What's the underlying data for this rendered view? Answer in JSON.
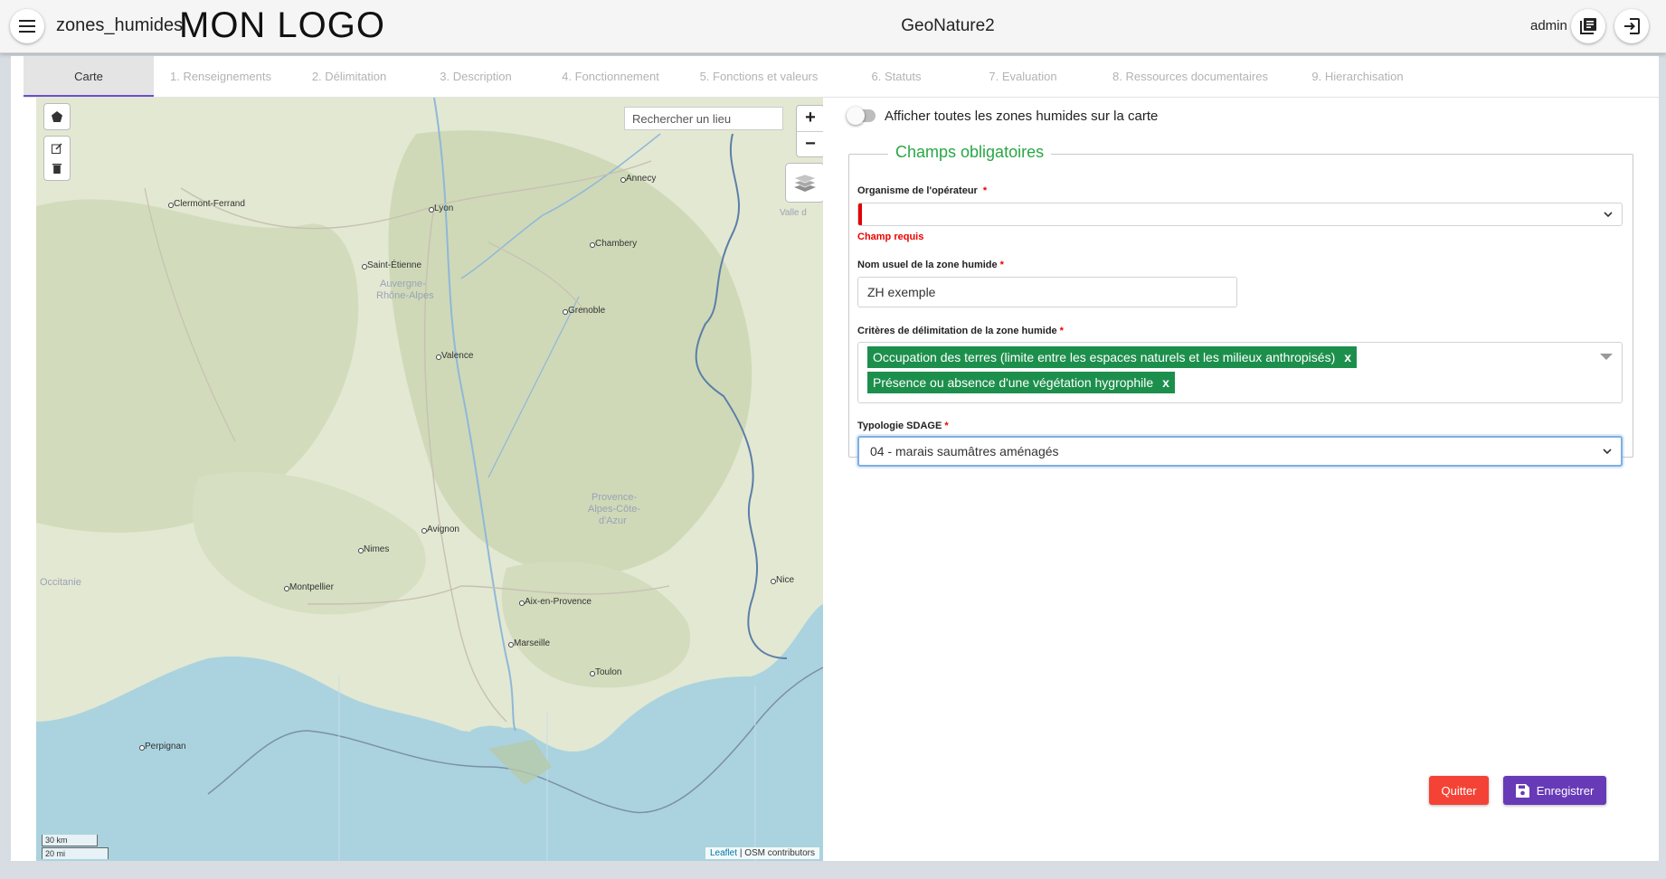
{
  "header": {
    "app_name": "zones_humides",
    "logo_text": "MON LOGO",
    "title": "GeoNature2",
    "user": "admin",
    "icons": [
      "menu-icon",
      "library-books-icon",
      "logout-icon"
    ]
  },
  "tabs": [
    {
      "label": "Carte",
      "active": true
    },
    {
      "label": "1. Renseignements"
    },
    {
      "label": "2. Délimitation"
    },
    {
      "label": "3. Description"
    },
    {
      "label": "4. Fonctionnement"
    },
    {
      "label": "5. Fonctions et valeurs"
    },
    {
      "label": "6. Statuts"
    },
    {
      "label": "7. Evaluation"
    },
    {
      "label": "8. Ressources documentaires"
    },
    {
      "label": "9. Hierarchisation"
    }
  ],
  "map": {
    "search_placeholder": "Rechercher un lieu",
    "zoom_in": "+",
    "zoom_out": "−",
    "cities": [
      "Clermont-Ferrand",
      "Lyon",
      "Annecy",
      "Chambery",
      "Saint-Étienne",
      "Grenoble",
      "Valence",
      "Avignon",
      "Nimes",
      "Montpellier",
      "Aix-en-Provence",
      "Marseille",
      "Toulon",
      "Nice",
      "Perpignan",
      "Valle d"
    ],
    "regions": [
      "Auvergne-",
      "Rhône-Alpes",
      "Provence-",
      "Alpes-Côte-",
      "d'Azur",
      "Occitanie"
    ],
    "scale": {
      "km": "30 km",
      "mi": "20 mi"
    },
    "attribution_link": "Leaflet",
    "attribution_text": "| OSM contributors",
    "colors": {
      "land": "#e3e8d2",
      "sea": "#aad3df",
      "border": "#5b7fa8"
    }
  },
  "form": {
    "toggle_label": "Afficher toutes les zones humides sur la carte",
    "toggle_on": false,
    "section_title": "Champs obligatoires",
    "fields": {
      "organisme": {
        "label": "Organisme de l'opérateur",
        "required_mark": "*",
        "value": "",
        "error": "Champ requis"
      },
      "nom": {
        "label": "Nom usuel de la zone humide",
        "required_mark": "*",
        "value": "ZH exemple"
      },
      "criteres": {
        "label": "Critères de délimitation de la zone humide",
        "required_mark": "*",
        "chips": [
          "Occupation des terres (limite entre les espaces naturels et les milieux anthropisés)",
          "Présence ou absence d'une végétation hygrophile"
        ],
        "chip_remove": "x"
      },
      "typologie": {
        "label": "Typologie SDAGE",
        "required_mark": "*",
        "value": "04 - marais saumâtres aménagés"
      }
    }
  },
  "actions": {
    "quit": "Quitter",
    "save": "Enregistrer",
    "colors": {
      "quit": "#f44336",
      "save": "#673ab7",
      "chip": "#1d8f4c",
      "legend": "#28a745",
      "error": "#e40000"
    }
  }
}
